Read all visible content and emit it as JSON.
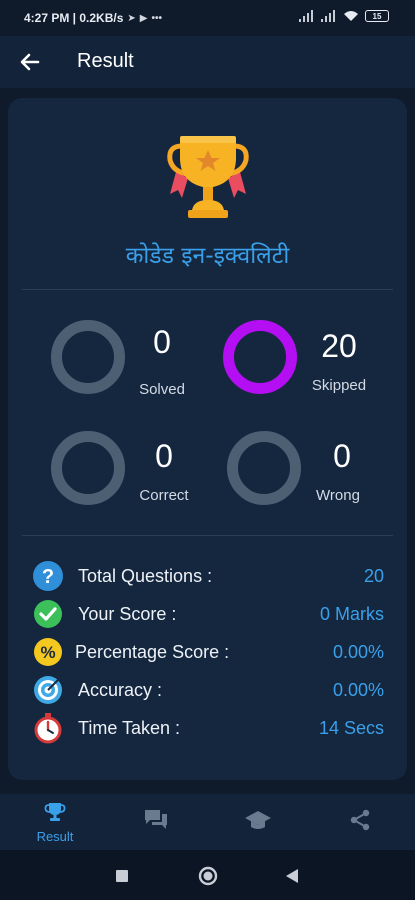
{
  "status_bar": {
    "time_info": "4:27 PM | 0.2KB/s",
    "battery": "15"
  },
  "app_bar": {
    "title": "Result"
  },
  "quiz": {
    "title": "कोडेड इन-इक्वलिटी"
  },
  "stats": {
    "solved": {
      "value": "0",
      "label": "Solved"
    },
    "skipped": {
      "value": "20",
      "label": "Skipped"
    },
    "correct": {
      "value": "0",
      "label": "Correct"
    },
    "wrong": {
      "value": "0",
      "label": "Wrong"
    }
  },
  "summary": [
    {
      "label": "Total Questions :",
      "value": "20",
      "icon": "question-icon"
    },
    {
      "label": "Your Score :",
      "value": "0 Marks",
      "icon": "check-icon"
    },
    {
      "label": "Percentage Score :",
      "value": "0.00%",
      "icon": "percent-icon"
    },
    {
      "label": "Accuracy :",
      "value": "0.00%",
      "icon": "target-icon"
    },
    {
      "label": "Time Taken :",
      "value": "14 Secs",
      "icon": "stopwatch-icon"
    }
  ],
  "bottom_nav": {
    "result_label": "Result"
  },
  "colors": {
    "accent": "#3aa0ea",
    "skipped_ring": "#b40ef2",
    "ring_inactive": "#4d5f72",
    "card": "#14273f",
    "background": "#0f1a2b"
  }
}
